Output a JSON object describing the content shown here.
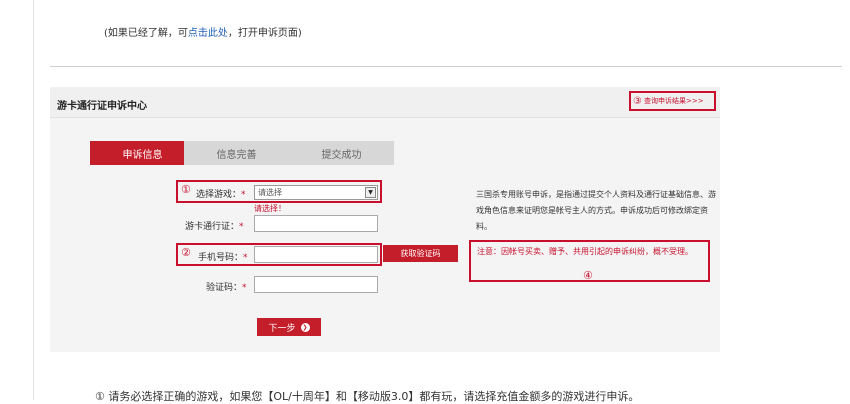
{
  "top_note": {
    "prefix": "(如果已经了解，可",
    "link": "点击此处",
    "suffix": "，打开申诉页面)"
  },
  "panel": {
    "title": "游卡通行证申诉中心",
    "query_num": "③",
    "query_link": "查询申诉结果>>>"
  },
  "steps": [
    "申诉信息",
    "信息完善",
    "提交成功"
  ],
  "form": {
    "game": {
      "num": "①",
      "label": "选择游戏：",
      "value": "请选择",
      "error": "请选择！"
    },
    "account": {
      "label": "游卡通行证："
    },
    "phone": {
      "num": "②",
      "label": "手机号码："
    },
    "code": {
      "label": "验证码："
    },
    "star": "*",
    "get_code_button": "获取验证码",
    "next_button": "下一步",
    "next_icon": "❯"
  },
  "info_text": "三国杀专用账号申诉，是指通过提交个人资料及通行证基础信息、游戏角色信息来证明您是帐号主人的方式。申诉成功后可修改绑定资料。",
  "notice": {
    "text": "注意：因帐号买卖、赠予、共用引起的申诉纠纷，概不受理。",
    "num": "④"
  },
  "bottom_note": "① 请务必选择正确的游戏，如果您【OL/十周年】和【移动版3.0】都有玩，请选择充值金额多的游戏进行申诉。",
  "colors": {
    "accent": "#c41e2a",
    "link": "#1e5fb4",
    "annotation": "#c8102e"
  }
}
